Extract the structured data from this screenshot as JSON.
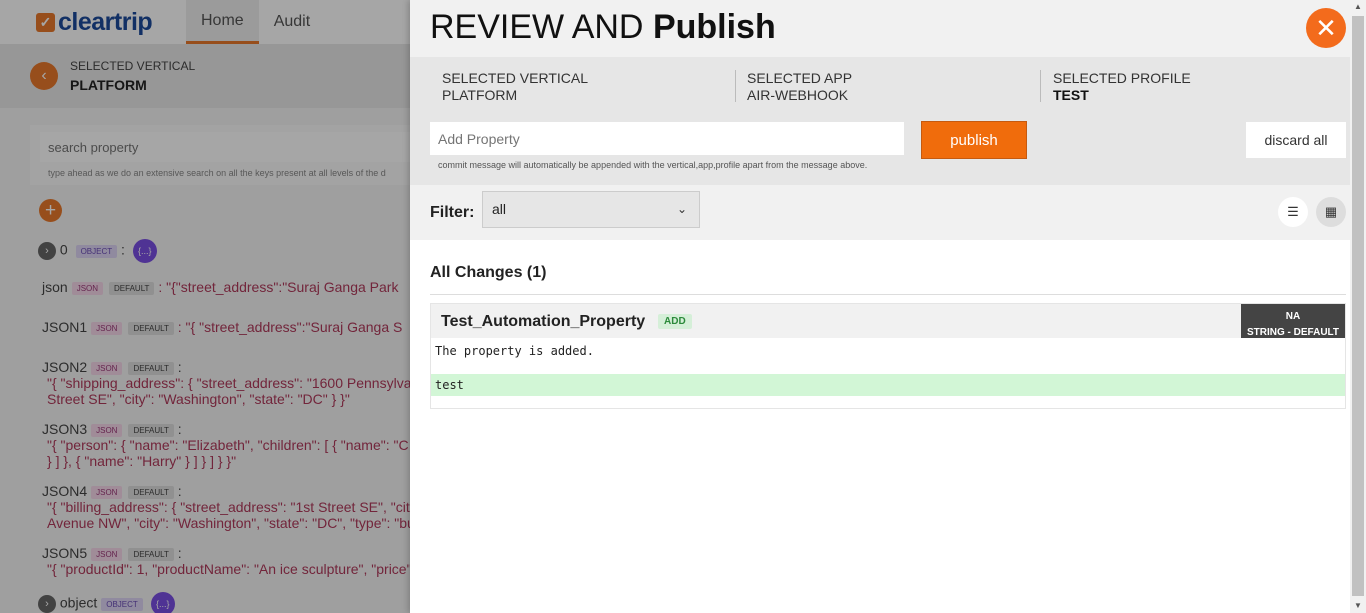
{
  "bg": {
    "logo": "cleartrip",
    "tabs": [
      "Home",
      "Audit"
    ],
    "vertical_label": "SELECTED VERTICAL",
    "vertical_value": "PLATFORM",
    "search_placeholder": "search property",
    "search_hint": "type ahead as we do an extensive search on all the keys present at all levels of the d",
    "object_index": "0",
    "object_tag": "OBJECT",
    "object_brace": "{...}",
    "props": [
      {
        "name": "json",
        "tag": "JSON",
        "def": "DEFAULT",
        "value": ": \"{\"street_address\":\"Suraj Ganga Park"
      },
      {
        "name": "JSON1",
        "tag": "JSON",
        "def": "DEFAULT",
        "value": ": \"{ \"street_address\":\"Suraj Ganga S"
      },
      {
        "name": "JSON2",
        "tag": "JSON",
        "def": "DEFAULT",
        "value": ":",
        "line1": "\"{ \"shipping_address\": { \"street_address\": \"1600 Pennsylva",
        "line2": "Street SE\", \"city\": \"Washington\", \"state\": \"DC\" } }\""
      },
      {
        "name": "JSON3",
        "tag": "JSON",
        "def": "DEFAULT",
        "value": ":",
        "line1": "\"{ \"person\": { \"name\": \"Elizabeth\", \"children\": [ { \"name\": \"C",
        "line2": "} ] }, { \"name\": \"Harry\" } ] } ] } }\""
      },
      {
        "name": "JSON4",
        "tag": "JSON",
        "def": "DEFAULT",
        "value": ":",
        "line1": "\"{ \"billing_address\": { \"street_address\": \"1st Street SE\", \"cit",
        "line2": "Avenue NW\", \"city\": \"Washington\", \"state\": \"DC\", \"type\": \"bu"
      },
      {
        "name": "JSON5",
        "tag": "JSON",
        "def": "DEFAULT",
        "value": ":",
        "line1": "\"{ \"productId\": 1, \"productName\": \"An ice sculpture\", \"price\""
      },
      {
        "name": "object",
        "tag": "OBJECT",
        "def": "",
        "value": "{...}"
      }
    ]
  },
  "panel": {
    "title_light": "REVIEW AND",
    "title_bold": "Publish",
    "close_icon": "close-icon",
    "meta": [
      {
        "label": "SELECTED VERTICAL",
        "value": "PLATFORM",
        "bold": false
      },
      {
        "label": "SELECTED APP",
        "value": "AIR-WEBHOOK",
        "bold": false
      },
      {
        "label": "SELECTED PROFILE",
        "value": "TEST",
        "bold": true
      }
    ],
    "add_property_placeholder": "Add Property",
    "commit_hint": "commit message will automatically be appended with the vertical,app,profile apart from the message above.",
    "publish_label": "publish",
    "discard_label": "discard all",
    "filter_label": "Filter:",
    "filter_value": "all",
    "changes_title": "All Changes (1)",
    "change": {
      "name": "Test_Automation_Property",
      "badge": "ADD",
      "type_line1": "NA",
      "type_line2": "STRING - DEFAULT",
      "description": "The property is added.",
      "diff": "test"
    }
  },
  "colors": {
    "accent": "#f06c0c",
    "brand": "#1d4b9b",
    "add_green": "#d2f6d6"
  }
}
